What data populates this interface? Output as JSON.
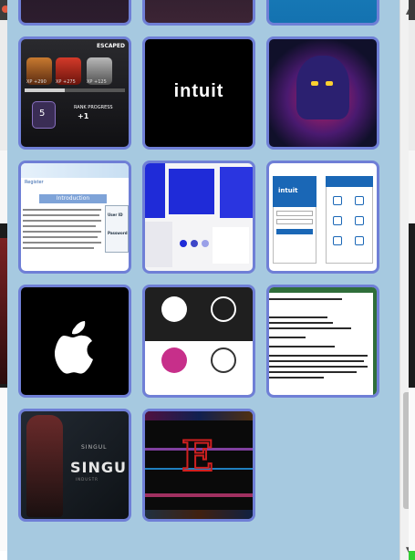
{
  "popup": {
    "tiles": [
      {
        "name": "thumbnail-gallery-1",
        "kind": "dark-gallery"
      },
      {
        "name": "thumbnail-gallery-2",
        "kind": "dark-gallery"
      },
      {
        "name": "thumbnail-gallery-3",
        "kind": "blue-gallery"
      },
      {
        "name": "thumbnail-game-badges",
        "text": {
          "status": "ESCAPED",
          "xp1": "XP +290",
          "xp2": "XP +275",
          "xp3": "XP +125",
          "rank_label": "RANK PROGRESS",
          "rank_value": "+1",
          "level": "5"
        }
      },
      {
        "name": "thumbnail-intuit-logo",
        "text": {
          "logo": "intuit"
        }
      },
      {
        "name": "thumbnail-neon-character"
      },
      {
        "name": "thumbnail-resident-register",
        "text": {
          "heading": "Register",
          "intro": "Introduction",
          "user_id": "User ID",
          "password": "Password"
        }
      },
      {
        "name": "thumbnail-blue-brand-mockup"
      },
      {
        "name": "thumbnail-intuit-app",
        "text": {
          "logo": "intuit",
          "login": "Login"
        }
      },
      {
        "name": "thumbnail-apple-logo",
        "text": {
          "logo": ""
        }
      },
      {
        "name": "thumbnail-logo-set"
      },
      {
        "name": "thumbnail-terminal-window"
      },
      {
        "name": "thumbnail-singularity",
        "text": {
          "big": "SINGU",
          "top": "SINGUL",
          "sub": "INDUSTR"
        }
      },
      {
        "name": "thumbnail-glitch-logo"
      }
    ]
  },
  "scrollbar": {
    "up_icon": "▲",
    "down_icon": "▼",
    "position_fraction": 0.92
  },
  "colors": {
    "panel_bg": "#a6c9e0",
    "tile_border": "#6f7fd6"
  }
}
